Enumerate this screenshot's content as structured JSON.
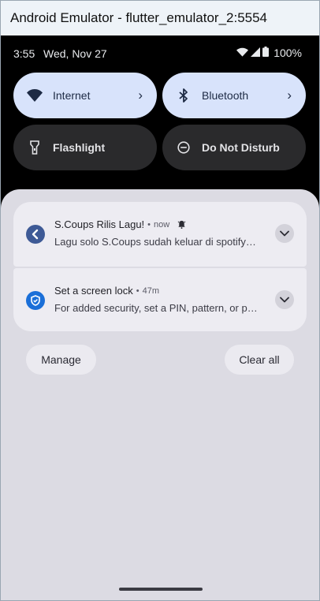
{
  "window": {
    "title": "Android Emulator - flutter_emulator_2:5554"
  },
  "status_bar": {
    "time": "3:55",
    "date": "Wed, Nov 27",
    "battery": "100%",
    "icons": [
      "wifi-icon",
      "cell-signal-icon",
      "battery-icon"
    ]
  },
  "quick_settings": {
    "tiles": [
      {
        "label": "Internet",
        "icon": "wifi-icon",
        "state": "on",
        "has_chevron": true
      },
      {
        "label": "Bluetooth",
        "icon": "bluetooth-icon",
        "state": "on",
        "has_chevron": true
      },
      {
        "label": "Flashlight",
        "icon": "flashlight-icon",
        "state": "off"
      },
      {
        "label": "Do Not Disturb",
        "icon": "do-not-disturb-icon",
        "state": "off"
      }
    ]
  },
  "notifications": [
    {
      "title": "S.Coups Rilis Lagu!",
      "time": "now",
      "text": "Lagu solo S.Coups sudah keluar di spotify…",
      "app_icon": "flutter-icon",
      "extra_icon": "alarm-bell-icon"
    },
    {
      "title": "Set a screen lock",
      "time": "47m",
      "text": "For added security, set a PIN, pattern, or p…",
      "app_icon": "shield-icon"
    }
  ],
  "actions": {
    "manage": "Manage",
    "clear_all": "Clear all"
  },
  "colors": {
    "active_tile": "#d8e3fb",
    "inactive_tile": "#2a2a2c",
    "shade": "#dcdbe3",
    "notification_card": "#edecf2"
  }
}
